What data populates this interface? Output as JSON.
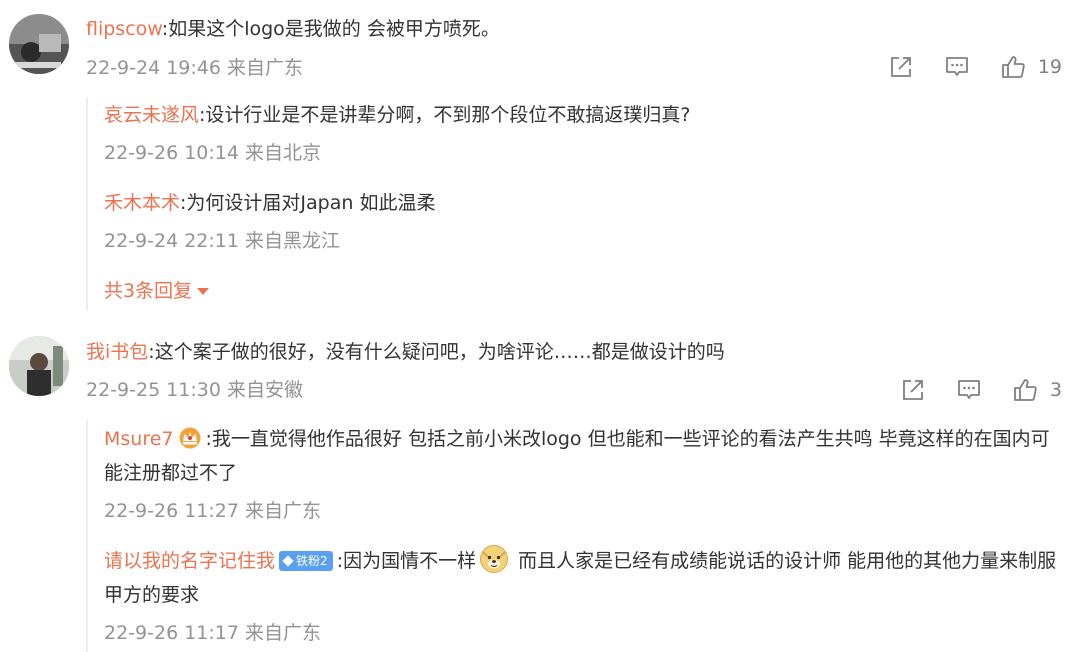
{
  "comments": [
    {
      "username": "flipscow",
      "sep": ":",
      "text": "如果这个logo是我做的 会被甲方喷死。",
      "meta": "22-9-24 19:46 来自广东",
      "likes": "19",
      "replies": [
        {
          "username": "哀云未遂风",
          "sep": ":",
          "text": "设计行业是不是讲辈分啊，不到那个段位不敢搞返璞归真?",
          "meta": "22-9-26 10:14 来自北京"
        },
        {
          "username": "禾木本术",
          "sep": ":",
          "text": "为何设计届对Japan 如此温柔",
          "meta": "22-9-24 22:11 来自黑龙江"
        }
      ],
      "more_label": "共3条回复"
    },
    {
      "username": "我i书包",
      "sep": ":",
      "text": "这个案子做的很好，没有什么疑问吧，为啥评论……都是做设计的吗",
      "meta": "22-9-25 11:30 来自安徽",
      "likes": "3",
      "replies": [
        {
          "username": "Msure7",
          "sep": ":",
          "text": "我一直觉得他作品很好 包括之前小米改logo 但也能和一些评论的看法产生共鸣 毕竟这样的在国内可能注册都过不了",
          "meta": "22-9-26 11:27 来自广东"
        },
        {
          "username": "请以我的名字记住我",
          "badge": "铁粉2",
          "sep": ":",
          "text_a": "因为国情不一样",
          "text_b": " 而且人家是已经有成绩能说话的设计师 能用他的其他力量来制服甲方的要求",
          "meta": "22-9-26 11:17 来自广东"
        }
      ]
    }
  ],
  "icons": [
    "share-icon",
    "comment-icon",
    "like-icon",
    "crown-badge-icon",
    "doge-emoji-icon"
  ],
  "colors": {
    "username": "#eb7350",
    "meta": "#939393",
    "text": "#333333",
    "icon": "#808080",
    "badge": "#5aa0f0"
  }
}
